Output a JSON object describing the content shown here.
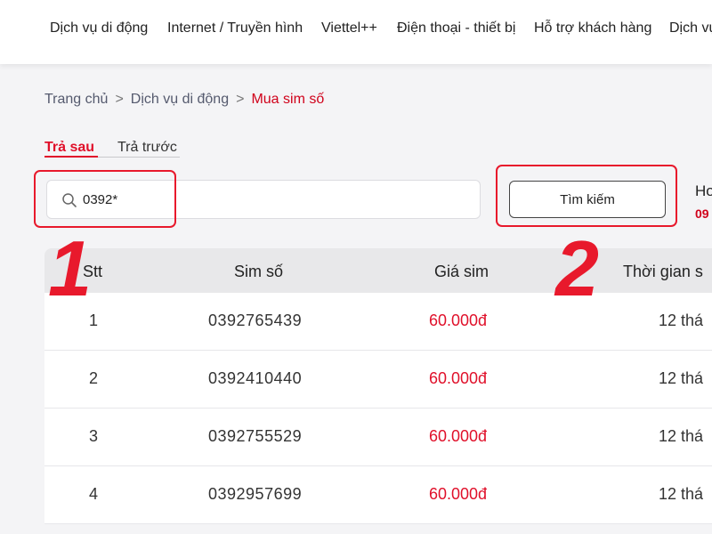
{
  "nav": {
    "items": [
      "Dịch vụ di động",
      "Internet / Truyền hình",
      "Viettel++",
      "Điện thoại - thiết bị",
      "Hỗ trợ khách hàng",
      "Dịch vụ"
    ]
  },
  "breadcrumb": {
    "home": "Trang chủ",
    "sep": ">",
    "parent": "Dịch vụ di động",
    "current": "Mua sim số"
  },
  "tabs": {
    "active": "Trả sau",
    "inactive": "Trả trước"
  },
  "search": {
    "value": "0392*",
    "button_label": "Tìm kiếm"
  },
  "side": {
    "title": "Ho",
    "value": "09"
  },
  "annotations": {
    "step1": "1",
    "step2": "2"
  },
  "table": {
    "headers": {
      "stt": "Stt",
      "sim": "Sim số",
      "price": "Giá sim",
      "time": "Thời gian s"
    },
    "rows": [
      {
        "stt": "1",
        "sim": "0392765439",
        "price": "60.000đ",
        "time": "12 thá"
      },
      {
        "stt": "2",
        "sim": "0392410440",
        "price": "60.000đ",
        "time": "12 thá"
      },
      {
        "stt": "3",
        "sim": "0392755529",
        "price": "60.000đ",
        "time": "12 thá"
      },
      {
        "stt": "4",
        "sim": "0392957699",
        "price": "60.000đ",
        "time": "12 thá"
      }
    ]
  },
  "colors": {
    "accent": "#e0102a",
    "annotation": "#e8192c"
  }
}
